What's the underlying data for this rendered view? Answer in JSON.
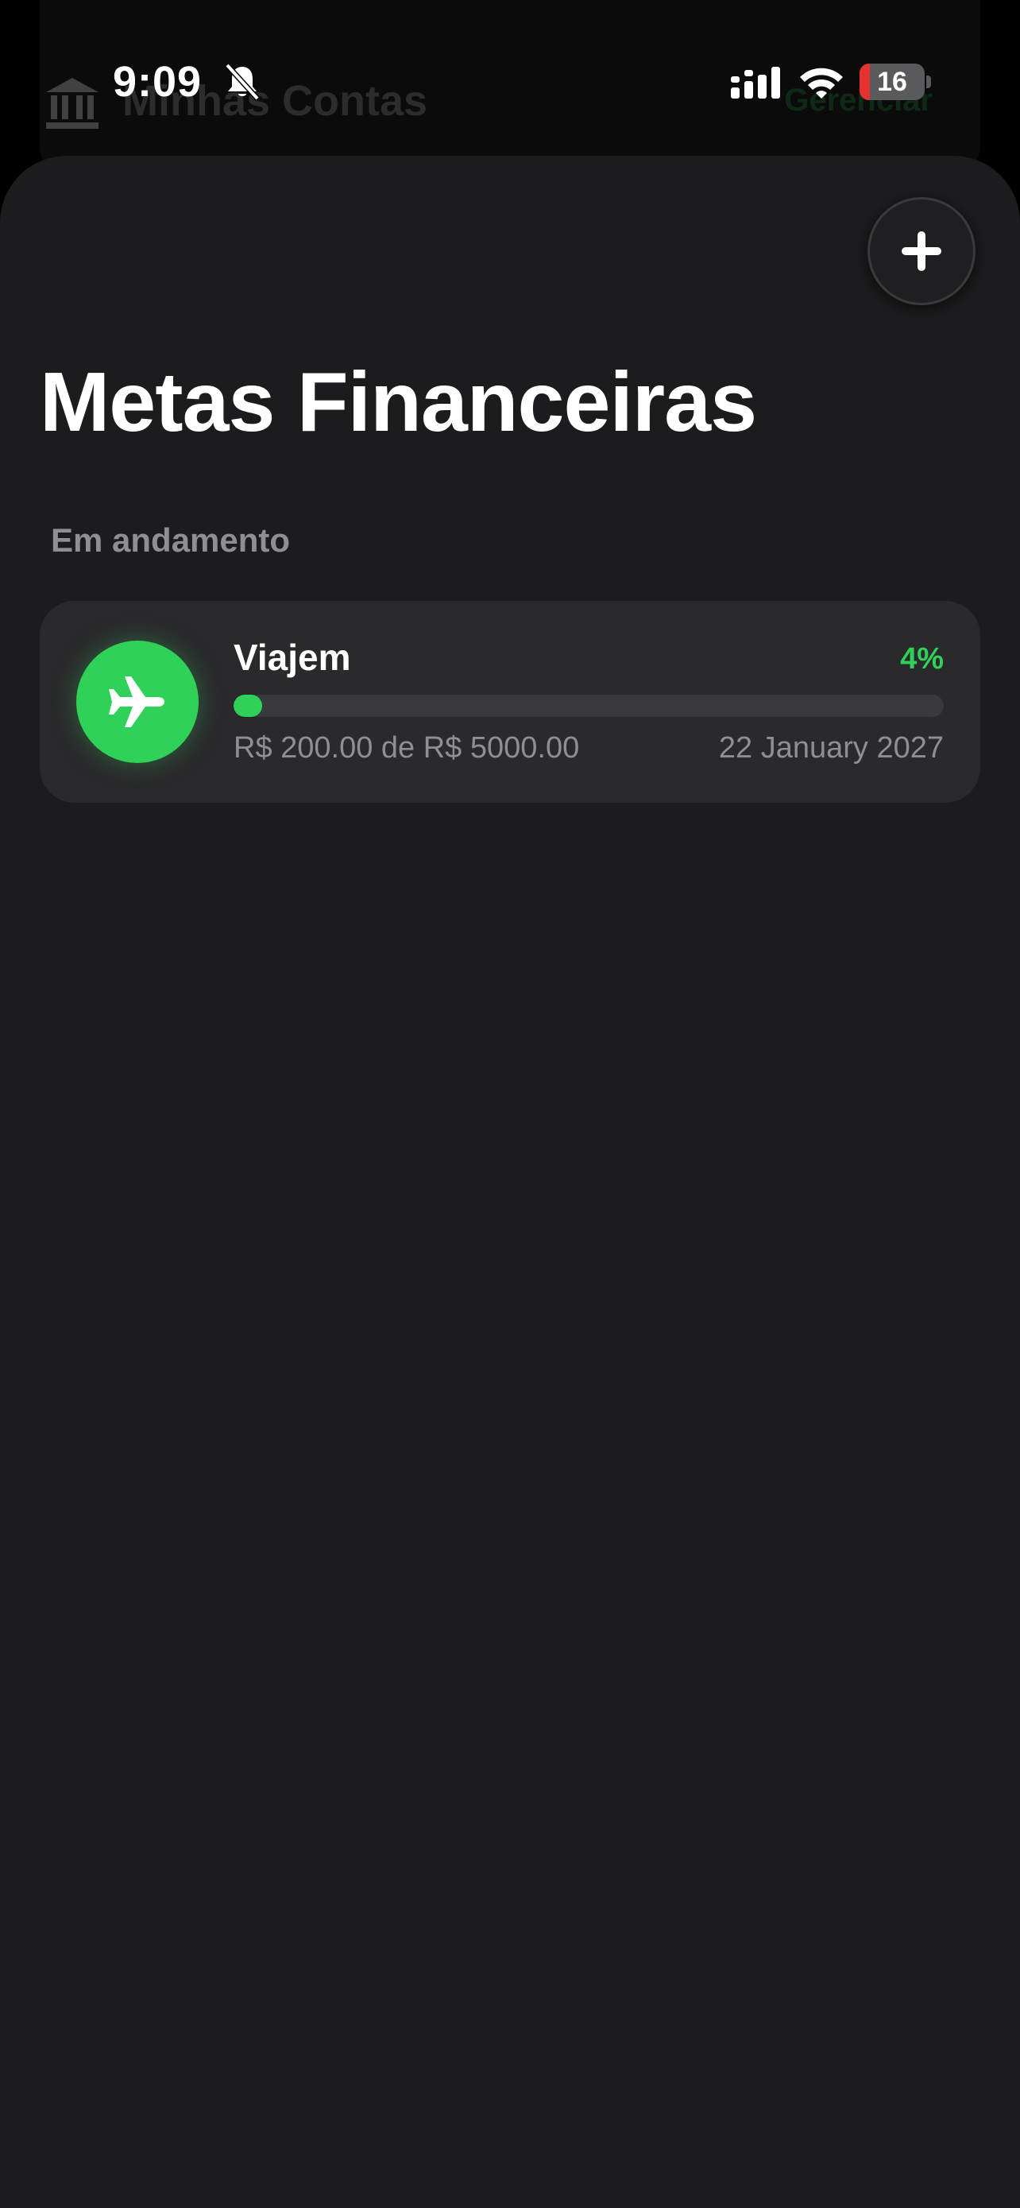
{
  "status_bar": {
    "time": "9:09",
    "battery_level": "16",
    "battery_fraction": 0.16,
    "icons": [
      "bell-slash-icon",
      "cellular-signal-icon",
      "wifi-icon",
      "battery-icon"
    ]
  },
  "background_page": {
    "title": "Minhas Contas",
    "manage_label": "Gerenciar",
    "icon": "bank-icon"
  },
  "header": {
    "add_icon": "plus-icon",
    "title": "Metas Financeiras"
  },
  "section": {
    "label": "Em andamento"
  },
  "goals": [
    {
      "name": "Viajem",
      "icon": "airplane-icon",
      "percent_label": "4%",
      "progress": 0.04,
      "amount_text": "R$ 200.00 de R$ 5000.00",
      "date": "22 January 2027"
    }
  ],
  "colors": {
    "accent": "#30d158",
    "sheet_background": "#1c1c1e",
    "card_background": "#2a2a2c",
    "secondary_text": "#8e8e93",
    "battery_low": "#e5322e"
  }
}
